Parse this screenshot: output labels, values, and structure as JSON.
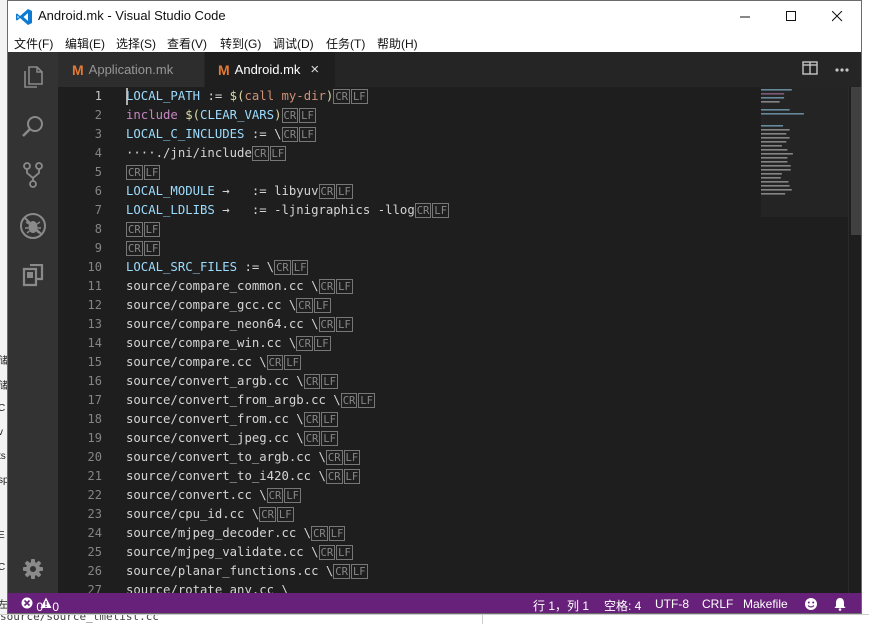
{
  "window": {
    "title": "Android.mk - Visual Studio Code"
  },
  "menu": [
    "文件(F)",
    "编辑(E)",
    "选择(S)",
    "查看(V)",
    "转到(G)",
    "调试(D)",
    "任务(T)",
    "帮助(H)"
  ],
  "tabs": [
    {
      "icon_letter": "M",
      "label": "Application.mk",
      "active": false
    },
    {
      "icon_letter": "M",
      "label": "Android.mk",
      "active": true,
      "close_glyph": "×"
    }
  ],
  "editor": {
    "lines": [
      {
        "n": "1",
        "parts": [
          {
            "t": "LOCAL_PATH",
            "c": "v"
          },
          {
            "t": " := ",
            "c": "d"
          },
          {
            "t": "$(",
            "c": "o"
          },
          {
            "t": "call my-dir",
            "c": "f"
          },
          {
            "t": ")",
            "c": "o"
          }
        ]
      },
      {
        "n": "2",
        "parts": [
          {
            "t": "include ",
            "c": "k"
          },
          {
            "t": "$(",
            "c": "o"
          },
          {
            "t": "CLEAR_VARS",
            "c": "v"
          },
          {
            "t": ")",
            "c": "o"
          }
        ]
      },
      {
        "n": "3",
        "parts": [
          {
            "t": "LOCAL_C_INCLUDES",
            "c": "v"
          },
          {
            "t": " := \\",
            "c": "d"
          }
        ]
      },
      {
        "n": "4",
        "parts": [
          {
            "t": "····./jni/include",
            "c": "d"
          }
        ]
      },
      {
        "n": "5",
        "parts": []
      },
      {
        "n": "6",
        "parts": [
          {
            "t": "LOCAL_MODULE",
            "c": "v"
          },
          {
            "t": " →   := libyuv",
            "c": "d"
          }
        ]
      },
      {
        "n": "7",
        "parts": [
          {
            "t": "LOCAL_LDLIBS",
            "c": "v"
          },
          {
            "t": " →   := -ljnigraphics -llog",
            "c": "d"
          }
        ]
      },
      {
        "n": "8",
        "parts": []
      },
      {
        "n": "9",
        "parts": []
      },
      {
        "n": "10",
        "parts": [
          {
            "t": "LOCAL_SRC_FILES",
            "c": "v"
          },
          {
            "t": " := \\",
            "c": "d"
          }
        ]
      },
      {
        "n": "11",
        "parts": [
          {
            "t": "source/compare_common.cc \\",
            "c": "d"
          }
        ]
      },
      {
        "n": "12",
        "parts": [
          {
            "t": "source/compare_gcc.cc \\",
            "c": "d"
          }
        ]
      },
      {
        "n": "13",
        "parts": [
          {
            "t": "source/compare_neon64.cc \\",
            "c": "d"
          }
        ]
      },
      {
        "n": "14",
        "parts": [
          {
            "t": "source/compare_win.cc \\",
            "c": "d"
          }
        ]
      },
      {
        "n": "15",
        "parts": [
          {
            "t": "source/compare.cc \\",
            "c": "d"
          }
        ]
      },
      {
        "n": "16",
        "parts": [
          {
            "t": "source/convert_argb.cc \\",
            "c": "d"
          }
        ]
      },
      {
        "n": "17",
        "parts": [
          {
            "t": "source/convert_from_argb.cc \\",
            "c": "d"
          }
        ]
      },
      {
        "n": "18",
        "parts": [
          {
            "t": "source/convert_from.cc \\",
            "c": "d"
          }
        ]
      },
      {
        "n": "19",
        "parts": [
          {
            "t": "source/convert_jpeg.cc \\",
            "c": "d"
          }
        ]
      },
      {
        "n": "20",
        "parts": [
          {
            "t": "source/convert_to_argb.cc \\",
            "c": "d"
          }
        ]
      },
      {
        "n": "21",
        "parts": [
          {
            "t": "source/convert_to_i420.cc \\",
            "c": "d"
          }
        ]
      },
      {
        "n": "22",
        "parts": [
          {
            "t": "source/convert.cc \\",
            "c": "d"
          }
        ]
      },
      {
        "n": "23",
        "parts": [
          {
            "t": "source/cpu_id.cc \\",
            "c": "d"
          }
        ]
      },
      {
        "n": "24",
        "parts": [
          {
            "t": "source/mjpeg_decoder.cc \\",
            "c": "d"
          }
        ]
      },
      {
        "n": "25",
        "parts": [
          {
            "t": "source/mjpeg_validate.cc \\",
            "c": "d"
          }
        ]
      },
      {
        "n": "26",
        "parts": [
          {
            "t": "source/planar_functions.cc \\",
            "c": "d"
          }
        ]
      },
      {
        "n": "27",
        "parts": [
          {
            "t": "source/rotate_any.cc \\",
            "c": "d"
          }
        ]
      }
    ],
    "eol_marks": [
      "CR",
      "LF"
    ]
  },
  "statusbar": {
    "errors": "0",
    "warnings": "0",
    "position": "行 1，列 1",
    "indent": "空格: 4",
    "encoding": "UTF-8",
    "eol": "CRLF",
    "language": "Makefile"
  },
  "colors": {
    "status_bg": "#68217a",
    "variable": "#9cdcfe",
    "keyword": "#c586c0",
    "operator": "#dcdcaa",
    "function_text": "#ce9178",
    "text": "#d4d4d4"
  },
  "background_fragments": {
    "left_edge": [
      "储",
      "储",
      "C",
      "v",
      "ts",
      "sp",
      "E",
      "C",
      "左"
    ],
    "bottom_edge": "source/source_tmelist.cc"
  }
}
